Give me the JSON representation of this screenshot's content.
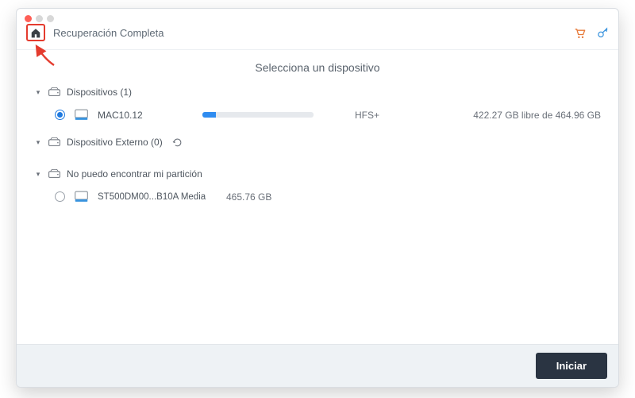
{
  "header": {
    "title": "Recuperación Completa"
  },
  "subtitle": "Selecciona un dispositivo",
  "sections": {
    "devices_label": "Dispositivos (1)",
    "external_label": "Dispositivo Externo (0)",
    "lost_label": "No puedo encontrar mi partición"
  },
  "device": {
    "name": "MAC10.12",
    "fs": "HFS+",
    "free": "422.27 GB libre de 464.96 GB",
    "progress_pct": 12
  },
  "media": {
    "name": "ST500DM00...B10A Media",
    "size": "465.76 GB"
  },
  "footer": {
    "start_label": "Iniciar"
  }
}
